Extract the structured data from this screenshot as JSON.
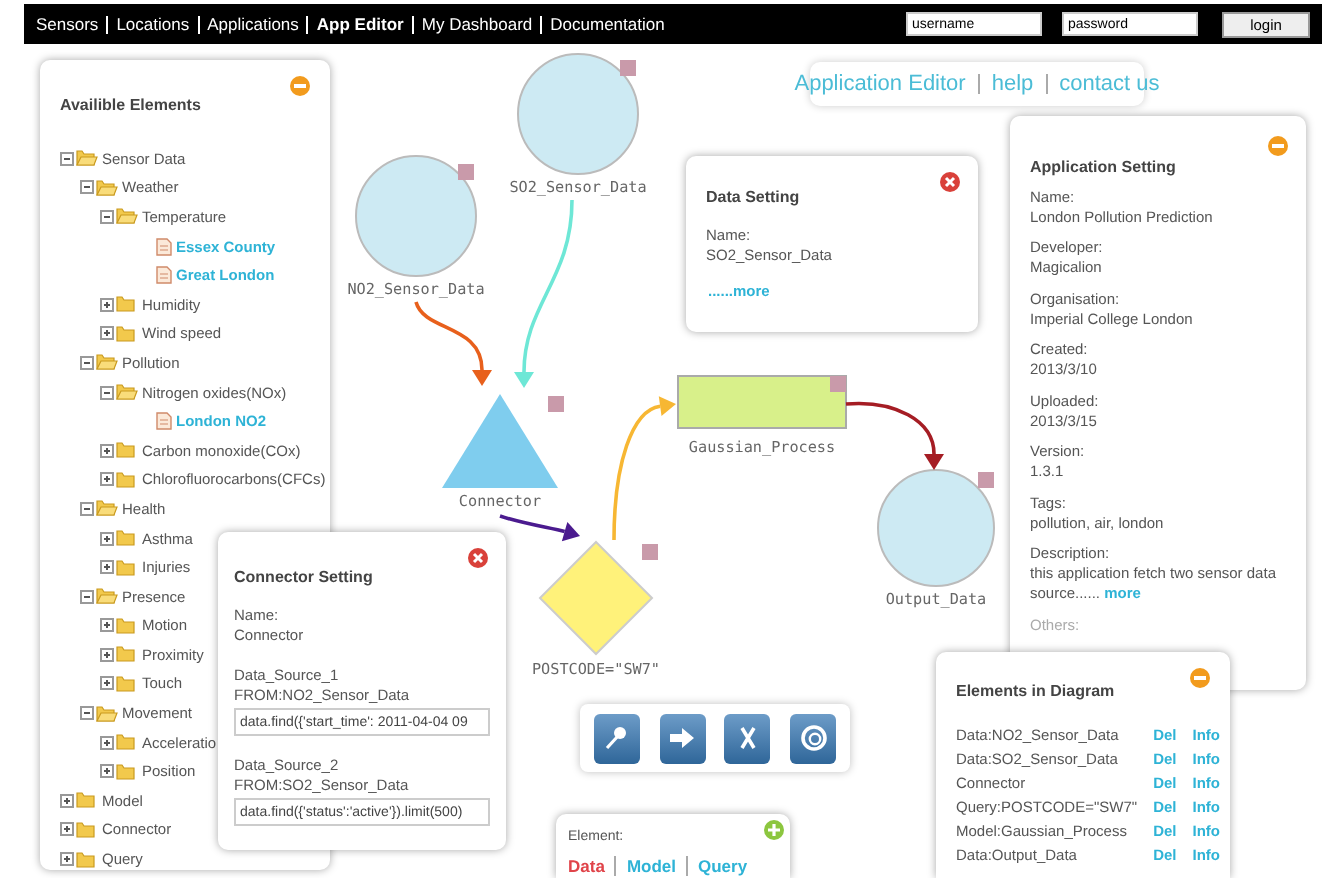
{
  "nav": {
    "links": [
      {
        "label": "Sensors",
        "selected": false
      },
      {
        "label": "Locations",
        "selected": false
      },
      {
        "label": "Applications",
        "selected": false
      },
      {
        "label": "App Editor",
        "selected": true
      },
      {
        "label": "My Dashboard",
        "selected": false
      },
      {
        "label": "Documentation",
        "selected": false
      }
    ],
    "username": {
      "placeholder": "username"
    },
    "password": {
      "placeholder": "password"
    },
    "login_button": "login"
  },
  "header_links": [
    "Application Editor",
    "help",
    "contact us"
  ],
  "elements_panel": {
    "title": "Availible Elements",
    "tree": [
      {
        "label": "Sensor Data",
        "kind": "folder",
        "expanded": true,
        "children": [
          {
            "label": "Weather",
            "kind": "folder",
            "expanded": true,
            "children": [
              {
                "label": "Temperature",
                "kind": "folder",
                "expanded": true,
                "children": [
                  {
                    "label": "Essex County",
                    "kind": "file"
                  },
                  {
                    "label": "Great London",
                    "kind": "file"
                  }
                ]
              },
              {
                "label": "Humidity",
                "kind": "folder",
                "expanded": false
              },
              {
                "label": "Wind speed",
                "kind": "folder",
                "expanded": false
              }
            ]
          },
          {
            "label": "Pollution",
            "kind": "folder",
            "expanded": true,
            "children": [
              {
                "label": "Nitrogen oxides(NOx)",
                "kind": "folder",
                "expanded": true,
                "children": [
                  {
                    "label": "London NO2",
                    "kind": "file"
                  }
                ]
              },
              {
                "label": "Carbon monoxide(COx)",
                "kind": "folder",
                "expanded": false
              },
              {
                "label": "Chlorofluorocarbons(CFCs)",
                "kind": "folder",
                "expanded": false
              }
            ]
          },
          {
            "label": "Health",
            "kind": "folder",
            "expanded": true,
            "children": [
              {
                "label": "Asthma",
                "kind": "folder",
                "expanded": false
              },
              {
                "label": "Injuries",
                "kind": "folder",
                "expanded": false
              }
            ]
          },
          {
            "label": "Presence",
            "kind": "folder",
            "expanded": true,
            "children": [
              {
                "label": "Motion",
                "kind": "folder",
                "expanded": false
              },
              {
                "label": "Proximity",
                "kind": "folder",
                "expanded": false
              },
              {
                "label": "Touch",
                "kind": "folder",
                "expanded": false
              }
            ]
          },
          {
            "label": "Movement",
            "kind": "folder",
            "expanded": true,
            "children": [
              {
                "label": "Acceleratio",
                "kind": "folder",
                "expanded": false
              },
              {
                "label": "Position",
                "kind": "folder",
                "expanded": false
              }
            ]
          }
        ]
      },
      {
        "label": "Model",
        "kind": "folder",
        "expanded": false
      },
      {
        "label": "Connector",
        "kind": "folder",
        "expanded": false
      },
      {
        "label": "Query",
        "kind": "folder",
        "expanded": false
      }
    ]
  },
  "diagram": {
    "nodes": [
      {
        "kind": "circle",
        "label": "NO2_Sensor_Data"
      },
      {
        "kind": "circle",
        "label": "SO2_Sensor_Data"
      },
      {
        "kind": "triangle",
        "label": "Connector"
      },
      {
        "kind": "diamond",
        "label": "POSTCODE=\"SW7\""
      },
      {
        "kind": "rect",
        "label": "Gaussian_Process"
      },
      {
        "kind": "circle",
        "label": "Output_Data"
      }
    ],
    "edges": [
      {
        "color": "#e8601c"
      },
      {
        "color": "#6ee7d6"
      },
      {
        "color": "#4b1b8f"
      },
      {
        "color": "#f7b733"
      },
      {
        "color": "#a51d24"
      }
    ]
  },
  "data_setting": {
    "title": "Data Setting",
    "fields": [
      {
        "label": "Name:",
        "value": "SO2_Sensor_Data"
      }
    ],
    "more_link": "......more"
  },
  "connector_setting": {
    "title": "Connector Setting",
    "fields": [
      {
        "label": "Name:",
        "value": "Connector"
      }
    ],
    "sources": [
      {
        "label": "Data_Source_1",
        "from": "FROM:NO2_Sensor_Data",
        "query": "data.find({'start_time': 2011-04-04 09"
      },
      {
        "label": "Data_Source_2",
        "from": "FROM:SO2_Sensor_Data",
        "query": "data.find({'status':'active'}).limit(500)"
      }
    ]
  },
  "application_setting": {
    "title": "Application Setting",
    "fields": [
      {
        "label": "Name:",
        "value": "London Pollution Prediction"
      },
      {
        "label": "Developer:",
        "value": "Magicalion"
      },
      {
        "label": "Organisation:",
        "value": "Imperial College London"
      },
      {
        "label": "Created:",
        "value": "2013/3/10"
      },
      {
        "label": "Uploaded:",
        "value": "2013/3/15"
      },
      {
        "label": "Version:",
        "value": "1.3.1"
      },
      {
        "label": "Tags:",
        "value": "pollution, air, london"
      }
    ],
    "description": {
      "label": "Description:",
      "text": "this application fetch two sensor data source......",
      "more_link": "more"
    },
    "others_label": "Others:"
  },
  "toolbar": [
    {
      "kind": "pin"
    },
    {
      "kind": "arrow"
    },
    {
      "kind": "cross"
    },
    {
      "kind": "target"
    }
  ],
  "elements_in_diagram": {
    "title": "Elements in Diagram",
    "rows": [
      {
        "name": "Data:NO2_Sensor_Data",
        "delete": "Del",
        "info": "Info"
      },
      {
        "name": "Data:SO2_Sensor_Data",
        "delete": "Del",
        "info": "Info"
      },
      {
        "name": "Connector",
        "delete": "Del",
        "info": "Info"
      },
      {
        "name": "Query:POSTCODE=\"SW7\"",
        "delete": "Del",
        "info": "Info"
      },
      {
        "name": "Model:Gaussian_Process",
        "delete": "Del",
        "info": "Info"
      },
      {
        "name": "Data:Output_Data",
        "delete": "Del",
        "info": "Info"
      }
    ]
  },
  "element_palette": {
    "title": "Element:",
    "tabs": [
      {
        "label": "Data",
        "selected": true
      },
      {
        "label": "Model",
        "selected": false
      },
      {
        "label": "Query",
        "selected": false
      }
    ]
  }
}
